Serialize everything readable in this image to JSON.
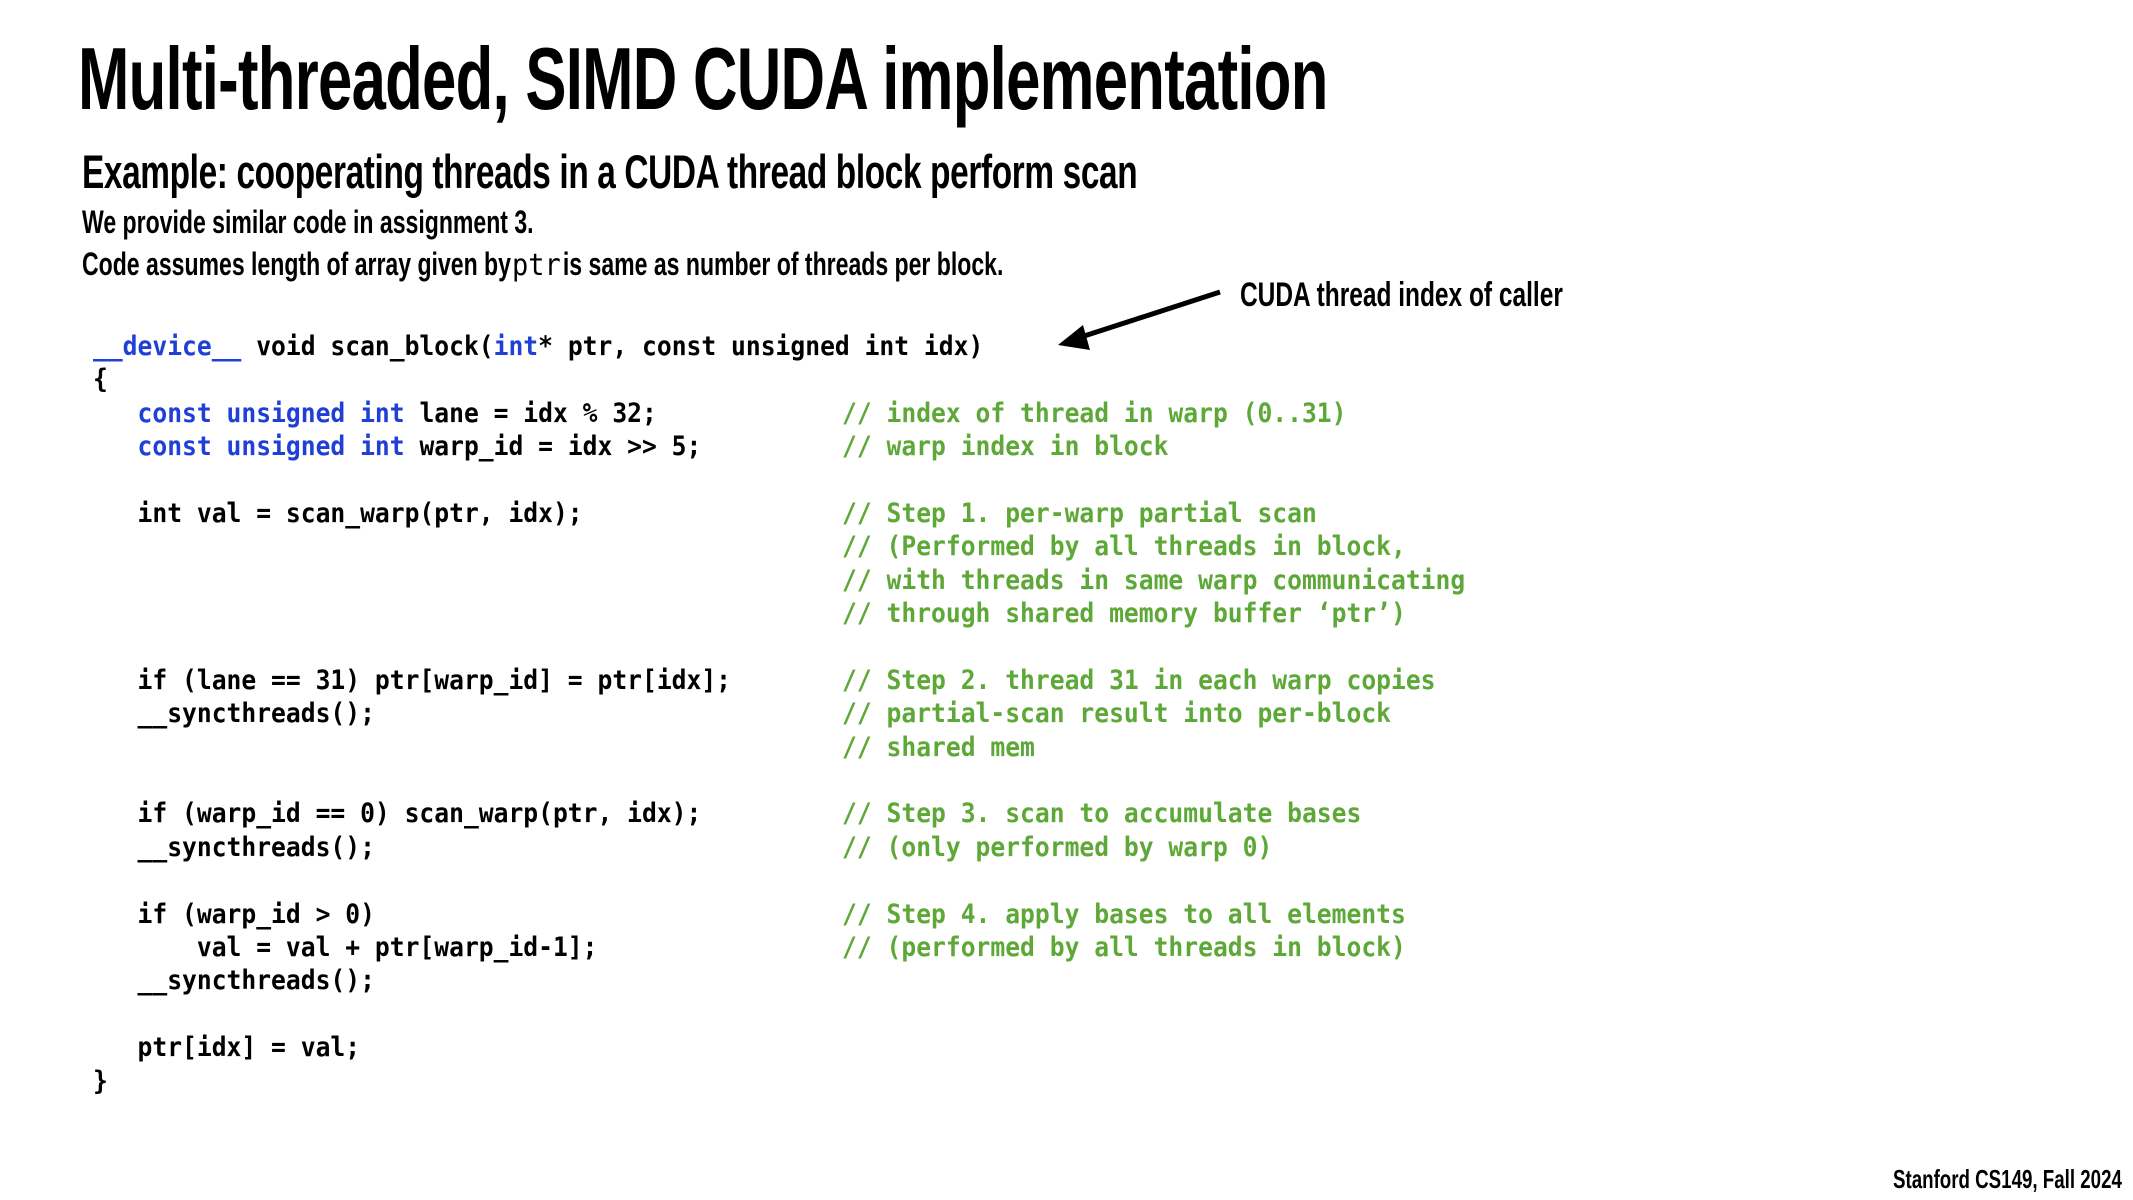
{
  "slide": {
    "title": "Multi-threaded, SIMD CUDA implementation",
    "subtitle": "Example: cooperating threads in a CUDA thread block perform scan",
    "note1": "We provide similar code in assignment 3.",
    "note2_before": "Code assumes length of array given by",
    "note2_code": "ptr",
    "note2_after": "is same as number of threads per block.",
    "annotation": "CUDA thread index of caller",
    "footer": "Stanford CS149, Fall 2024"
  },
  "colors": {
    "keyword": "#1f3fd6",
    "comment": "#5ea838",
    "text": "#000000"
  },
  "code": {
    "lines": [
      {
        "parts": [
          {
            "t": "__device__",
            "k": true
          },
          {
            "t": " void scan_block("
          },
          {
            "t": "int",
            "k": true
          },
          {
            "t": "* ptr, const unsigned int idx)"
          }
        ],
        "comment": ""
      },
      {
        "parts": [
          {
            "t": "{"
          }
        ],
        "comment": ""
      },
      {
        "parts": [
          {
            "t": "   "
          },
          {
            "t": "const unsigned int",
            "k": true
          },
          {
            "t": " lane = idx % 32;"
          }
        ],
        "comment": "// index of thread in warp (0..31)"
      },
      {
        "parts": [
          {
            "t": "   "
          },
          {
            "t": "const unsigned int",
            "k": true
          },
          {
            "t": " warp_id = idx >> 5;"
          }
        ],
        "comment": "// warp index in block"
      },
      {
        "parts": [],
        "comment": ""
      },
      {
        "parts": [
          {
            "t": "   int val = scan_warp(ptr, idx);"
          }
        ],
        "comment": "// Step 1. per-warp partial scan"
      },
      {
        "parts": [],
        "comment": "// (Performed by all threads in block,"
      },
      {
        "parts": [],
        "comment": "// with threads in same warp communicating"
      },
      {
        "parts": [],
        "comment": "// through shared memory buffer ‘ptr’)"
      },
      {
        "parts": [],
        "comment": ""
      },
      {
        "parts": [
          {
            "t": "   if (lane == 31) ptr[warp_id] = ptr[idx];"
          }
        ],
        "comment": "// Step 2. thread 31 in each warp copies"
      },
      {
        "parts": [
          {
            "t": "   __syncthreads();"
          }
        ],
        "comment": "// partial-scan result into per-block"
      },
      {
        "parts": [],
        "comment": "// shared mem"
      },
      {
        "parts": [],
        "comment": ""
      },
      {
        "parts": [
          {
            "t": "   if (warp_id == 0) scan_warp(ptr, idx);"
          }
        ],
        "comment": "// Step 3. scan to accumulate bases"
      },
      {
        "parts": [
          {
            "t": "   __syncthreads();"
          }
        ],
        "comment": "// (only performed by warp 0)"
      },
      {
        "parts": [],
        "comment": ""
      },
      {
        "parts": [
          {
            "t": "   if (warp_id > 0)"
          }
        ],
        "comment": "// Step 4. apply bases to all elements"
      },
      {
        "parts": [
          {
            "t": "       val = val + ptr[warp_id-1];"
          }
        ],
        "comment": "// (performed by all threads in block)"
      },
      {
        "parts": [
          {
            "t": "   __syncthreads();"
          }
        ],
        "comment": ""
      },
      {
        "parts": [],
        "comment": ""
      },
      {
        "parts": [
          {
            "t": "   ptr[idx] = val;"
          }
        ],
        "comment": ""
      },
      {
        "parts": [
          {
            "t": "}"
          }
        ],
        "comment": ""
      }
    ]
  }
}
